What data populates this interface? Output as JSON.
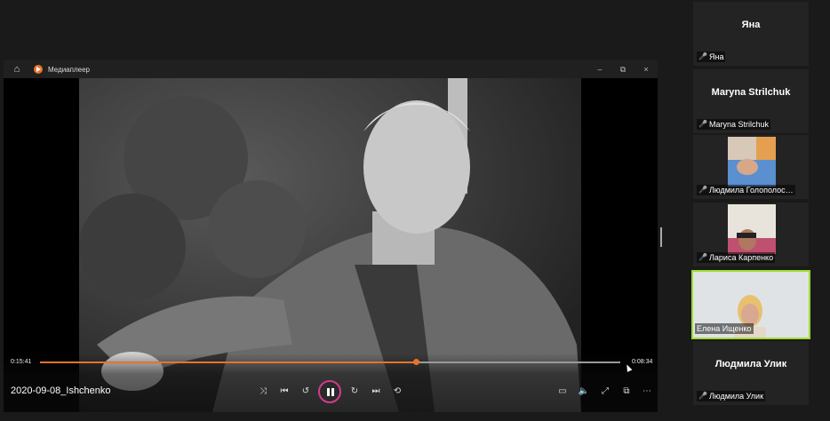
{
  "player": {
    "window_title": "Медиаплеер",
    "minimize": "–",
    "maximize": "⧉",
    "close": "×",
    "current_time": "0:15:41",
    "total_time": "0:08:34",
    "progress": 0.648,
    "file_name": "2020-09-08_Ishchenko",
    "accent_color": "#e8732a"
  },
  "gallery": {
    "raise_hand_icon": "raised-hand-icon",
    "more_icon": "more-dots-icon",
    "participants": [
      {
        "display_name": "Яна",
        "label": "Яна",
        "muted": true,
        "video": false,
        "active": false
      },
      {
        "display_name": "Maryna Strilchuk",
        "label": "Maryna Strilchuk",
        "muted": true,
        "video": false,
        "active": false
      },
      {
        "display_name": "",
        "label": "Людмила Голополос…",
        "muted": true,
        "video": true,
        "active": false
      },
      {
        "display_name": "",
        "label": "Лариса Карпенко",
        "muted": true,
        "video": true,
        "active": false
      },
      {
        "display_name": "",
        "label": "Елена Ищенко",
        "muted": false,
        "video": true,
        "active": true
      },
      {
        "display_name": "Людмила Улик",
        "label": "Людмила Улик",
        "muted": true,
        "video": false,
        "active": false
      }
    ],
    "active_speaker_color": "#9fdc32"
  }
}
